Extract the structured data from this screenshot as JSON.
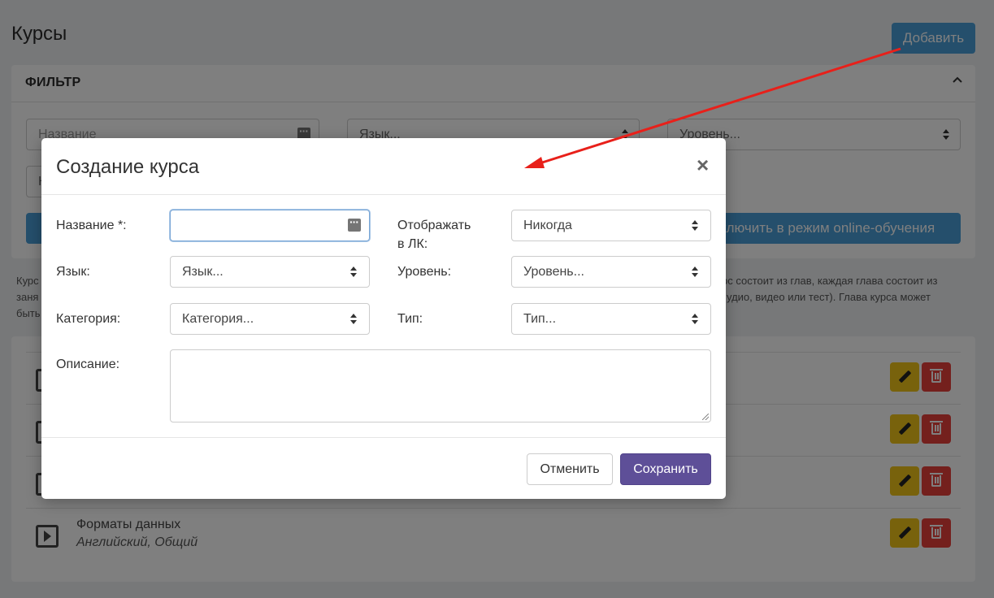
{
  "page": {
    "title": "Курсы",
    "add_button": "Добавить"
  },
  "filter": {
    "title": "ФИЛЬТР",
    "name_placeholder": "Название",
    "language_placeholder": "Язык...",
    "level_placeholder": "Уровень...",
    "category_partial": "К",
    "apply_partial": "",
    "online_mode_button": "ключить в режим online-обучения"
  },
  "info": {
    "line1_left": "Курс",
    "line1_right": "рс состоит из глав, каждая глава состоит из",
    "line2_left": "заня",
    "line2_right": "удио, видео или тест). Глава курса может",
    "line3_left": "быть"
  },
  "courses": [
    {
      "title": "",
      "subtitle": ""
    },
    {
      "title": "",
      "subtitle": ""
    },
    {
      "title": "",
      "subtitle": ""
    },
    {
      "title": "Форматы данных",
      "subtitle": "Английский, Общий"
    }
  ],
  "modal": {
    "title": "Создание курса",
    "close": "×",
    "labels": {
      "name": "Название *:",
      "display_line1": "Отображать",
      "display_line2": "в ЛК:",
      "language": "Язык:",
      "level": "Уровень:",
      "category": "Категория:",
      "type": "Тип:",
      "description": "Описание:"
    },
    "values": {
      "name": "",
      "display": "Никогда",
      "language": "Язык...",
      "level": "Уровень...",
      "category": "Категория...",
      "type": "Тип...",
      "description": ""
    },
    "cancel": "Отменить",
    "save": "Сохранить"
  },
  "colors": {
    "primary": "#4a9fd8",
    "save": "#5e4f98",
    "edit": "#f0c419",
    "delete": "#e8413b",
    "annotation_arrow": "#e8201a"
  }
}
